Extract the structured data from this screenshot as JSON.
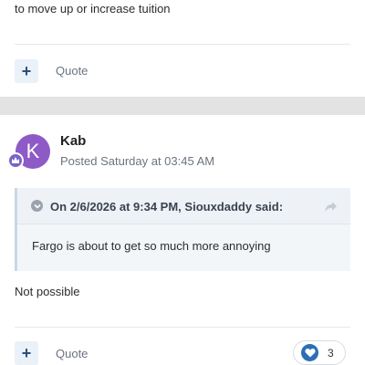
{
  "previous_post": {
    "text": "to move up or increase tuition",
    "add_label": "+",
    "quote_label": "Quote"
  },
  "post": {
    "avatar_letter": "K",
    "author": "Kab",
    "posted": "Posted Saturday at 03:45 AM",
    "quote": {
      "header": "On 2/6/2026 at 9:34 PM, Siouxdaddy said:",
      "body": "Fargo is about to get so much more annoying"
    },
    "text": "Not possible",
    "add_label": "+",
    "quote_label": "Quote",
    "reaction": {
      "icon": "heart-icon",
      "count": "3"
    }
  },
  "colors": {
    "accent": "#2c6fb3",
    "avatar": "#8e5ac6",
    "muted_text": "#6b7480"
  }
}
